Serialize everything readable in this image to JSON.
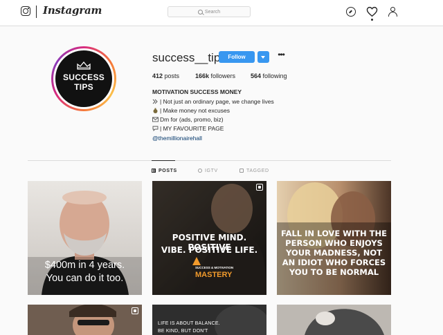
{
  "nav": {
    "wordmark": "Instagram",
    "search_placeholder": "Search",
    "icons": [
      "instagram-glyph-icon",
      "compass-icon",
      "heart-icon",
      "person-icon"
    ]
  },
  "profile": {
    "avatar_line1": "SUCCESS",
    "avatar_line2": "TIPS",
    "username": "success__tips",
    "follow_label": "Follow",
    "options_label": "•••",
    "stats": {
      "posts_num": "412",
      "posts_label": " posts",
      "followers_num": "166k",
      "followers_label": " followers",
      "following_num": "564",
      "following_label": " following"
    },
    "bio": {
      "name": "MOTIVATION SUCCESS MONEY",
      "line1": "| Not just an ordinary page, we change lives",
      "line2": "| Make money not excuses",
      "line3": "Dm for (ads, promo, biz)",
      "line4": "| MY FAVOURITE PAGE",
      "link": "@themillionairehall"
    }
  },
  "tabs": [
    {
      "label": "POSTS",
      "active": true
    },
    {
      "label": "IGTV",
      "active": false
    },
    {
      "label": "TAGGED",
      "active": false
    }
  ],
  "posts": [
    {
      "caption_line1": "$400m in 4 years.",
      "caption_line2": "You can do it too."
    },
    {
      "caption_line1": "POSITIVE MIND. POSITIVE",
      "caption_line2": "VIBE. POSITIVE LIFE.",
      "logo_top": "SUCCESS & MOTIVATION",
      "logo_main": "MASTERY"
    },
    {
      "lines": [
        "FALL IN LOVE WITH THE",
        "PERSON WHO ENJOYS",
        "YOUR MADNESS, NOT",
        "AN IDIOT WHO FORCES",
        "YOU TO BE NORMAL"
      ]
    },
    {
      "partial_line1": "LIFE IS ABOUT BALANCE.",
      "partial_line2": "BE KIND, BUT DON'T"
    }
  ],
  "colors": {
    "accent": "#3897f0",
    "link": "#003569",
    "border": "#dbdbdb"
  }
}
